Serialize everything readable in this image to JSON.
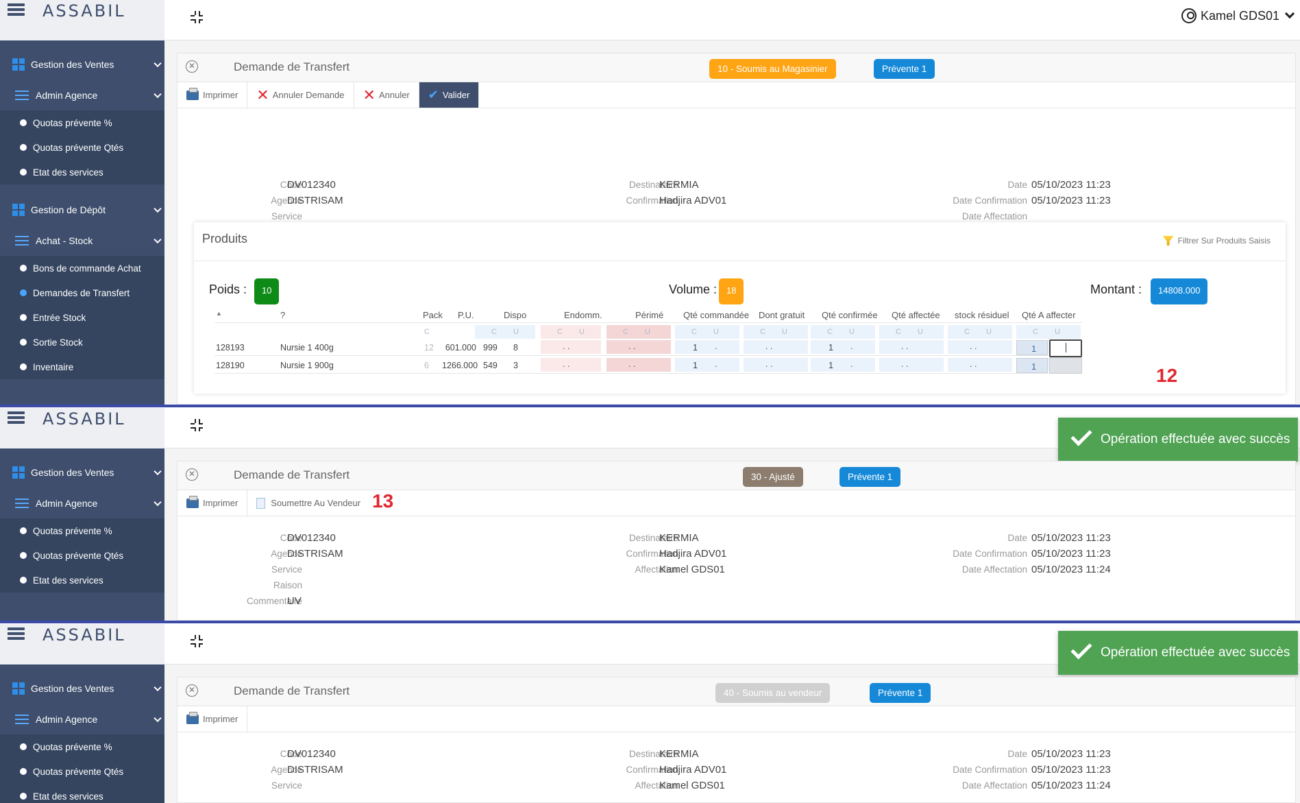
{
  "app": {
    "logo": "ASSABIL",
    "user": "Kamel GDS01"
  },
  "sidebar": {
    "groups": [
      "Gestion des Ventes",
      "Admin Agence",
      "Gestion de Dépôt",
      "Achat - Stock"
    ],
    "admin_items": [
      "Quotas prévente %",
      "Quotas prévente Qtés",
      "Etat des services"
    ],
    "stock_items": [
      "Bons de commande Achat",
      "Demandes de Transfert",
      "Entrée Stock",
      "Sortie Stock",
      "Inventaire"
    ]
  },
  "doc": {
    "title": "Demande de Transfert",
    "fields": {
      "code_label": "Code",
      "code": "DV012340",
      "agence_label": "Agence",
      "agence": "DISTRISAM",
      "service_label": "Service",
      "raison_label": "Raison",
      "commentaire_label": "Commentaire",
      "commentaire": "UV",
      "destinataire_label": "Destinataire",
      "destinataire": "KERMIA",
      "confirmation_label": "Confirmation",
      "confirmation": "Hadjira ADV01",
      "affectation_label": "Affectation",
      "affectation": "Kamel GDS01",
      "date_label": "Date",
      "date": "05/10/2023 11:23",
      "date_conf_label": "Date Confirmation",
      "date_conf": "05/10/2023 11:23",
      "date_aff_label": "Date Affectation",
      "date_aff": "05/10/2023 11:24"
    }
  },
  "screen1": {
    "status": "10 - Soumis au Magasinier",
    "status_color": "#ffa412",
    "prevente": "Prévente 1",
    "toolbar": [
      "Imprimer",
      "Annuler Demande",
      "Annuler",
      "Valider"
    ]
  },
  "screen2": {
    "status": "30 - Ajusté",
    "status_color": "#8c7d6e",
    "prevente": "Prévente 1",
    "toolbar": [
      "Imprimer",
      "Soumettre Au Vendeur"
    ],
    "annotation": "13",
    "toast": "Opération effectuée avec succès"
  },
  "screen3": {
    "status": "40 - Soumis au vendeur",
    "status_color": "#d0d0d0",
    "prevente": "Prévente 1",
    "toolbar": [
      "Imprimer"
    ],
    "toast": "Opération effectuée avec succès"
  },
  "produits": {
    "title": "Produits",
    "filter": "Filtrer Sur Produits Saisis",
    "poids_label": "Poids :",
    "poids": "10",
    "volume_label": "Volume :",
    "volume": "18",
    "montant_label": "Montant :",
    "montant": "14808.000",
    "columns": [
      "?",
      "Pack",
      "P.U.",
      "Dispo",
      "Endomm.",
      "Périmé",
      "Qté commandée",
      "Dont gratuit",
      "Qté confirmée",
      "Qté affectée",
      "stock résiduel",
      "Qté A affecter"
    ],
    "sub_c": "C",
    "sub_u": "U",
    "dots": ". .",
    "rows": [
      {
        "code": "128193",
        "name": "Nursie 1 400g",
        "pack": "12",
        "pu": "601.000",
        "dispo_c": "999",
        "dispo_u": "8",
        "cmd": "1",
        "conf": "1",
        "aff": "1"
      },
      {
        "code": "128190",
        "name": "Nursie 1 900g",
        "pack": "6",
        "pu": "1266.000",
        "dispo_c": "549",
        "dispo_u": "3",
        "cmd": "1",
        "conf": "1",
        "aff": "1"
      }
    ],
    "annotation": "12"
  }
}
